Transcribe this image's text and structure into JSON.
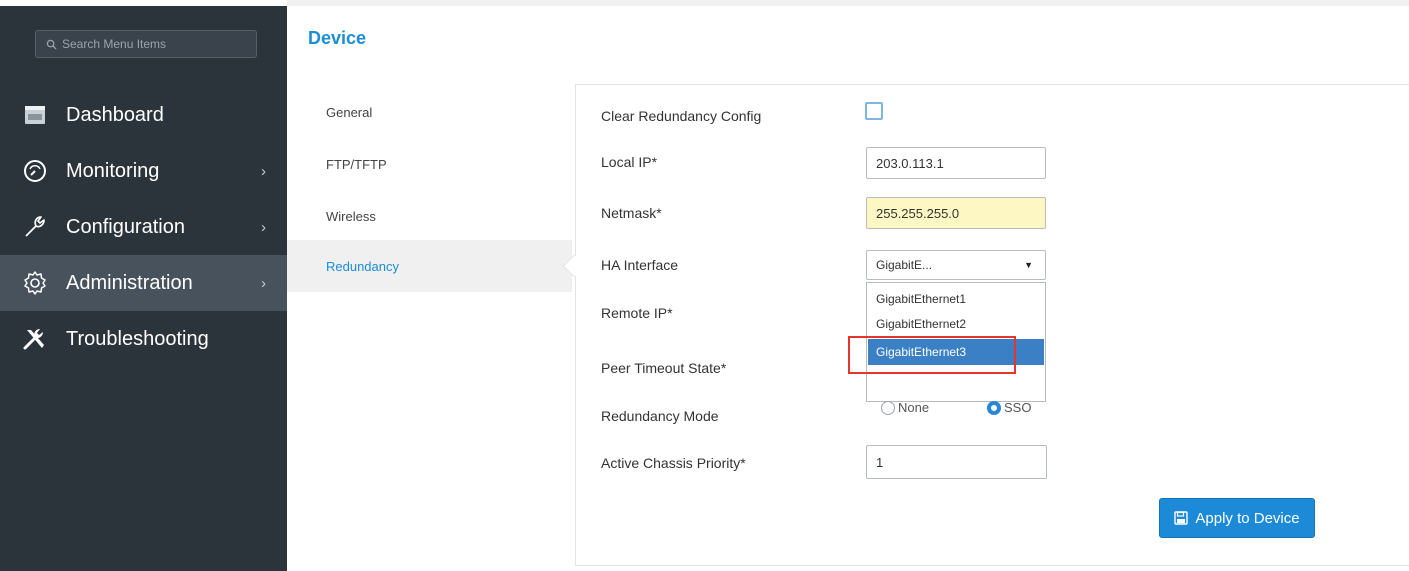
{
  "sidebar": {
    "search_placeholder": "Search Menu Items",
    "items": [
      {
        "label": "Dashboard",
        "icon": "dashboard-icon",
        "has_chevron": false,
        "active": false
      },
      {
        "label": "Monitoring",
        "icon": "gauge-icon",
        "has_chevron": true,
        "active": false
      },
      {
        "label": "Configuration",
        "icon": "wrench-icon",
        "has_chevron": true,
        "active": false
      },
      {
        "label": "Administration",
        "icon": "gear-icon",
        "has_chevron": true,
        "active": true
      },
      {
        "label": "Troubleshooting",
        "icon": "tools-icon",
        "has_chevron": false,
        "active": false
      }
    ],
    "chevron": "›"
  },
  "header": {
    "title": "Device"
  },
  "subnav": {
    "items": [
      {
        "label": "General",
        "active": false
      },
      {
        "label": "FTP/TFTP",
        "active": false
      },
      {
        "label": "Wireless",
        "active": false
      },
      {
        "label": "Redundancy",
        "active": true
      }
    ]
  },
  "form": {
    "clear_redundancy_label": "Clear Redundancy Config",
    "clear_redundancy_checked": false,
    "local_ip_label": "Local IP*",
    "local_ip_value": "203.0.113.1",
    "netmask_label": "Netmask*",
    "netmask_value": "255.255.255.0",
    "ha_interface_label": "HA Interface",
    "ha_interface_value": "GigabitE...",
    "ha_interface_options": [
      "GigabitEthernet1",
      "GigabitEthernet2",
      "GigabitEthernet3"
    ],
    "ha_interface_highlighted": "GigabitEthernet3",
    "remote_ip_label": "Remote IP*",
    "peer_timeout_label": "Peer Timeout State*",
    "redundancy_mode_label": "Redundancy Mode",
    "redundancy_mode_options": [
      "None",
      "SSO"
    ],
    "redundancy_mode_selected": "SSO",
    "active_chassis_priority_label": "Active Chassis Priority*",
    "active_chassis_priority_value": "1",
    "apply_button_label": "Apply to Device"
  },
  "colors": {
    "sidebar_bg": "#2b333b",
    "accent": "#1a8ed6",
    "highlight_border": "#e8352a",
    "netmask_bg": "#fdf8c3"
  }
}
